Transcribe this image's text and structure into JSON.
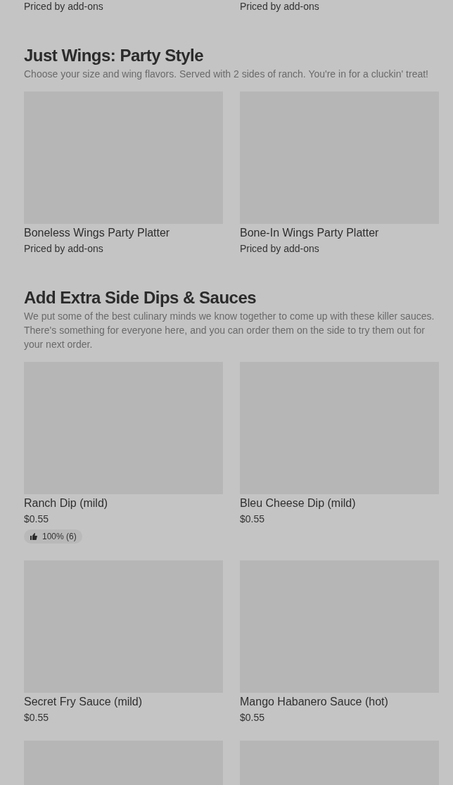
{
  "top_row": [
    {
      "price": "Priced by add-ons"
    },
    {
      "price": "Priced by add-ons"
    }
  ],
  "sections": [
    {
      "title": "Just Wings: Party Style",
      "description": "Choose your size and wing flavors. Served with 2 sides of ranch. You're in for a cluckin' treat!",
      "items": [
        {
          "kind": "product",
          "name": "Boneless Wings Party Platter",
          "price": "Priced by add-ons"
        },
        {
          "kind": "product",
          "name": "Bone-In Wings Party Platter",
          "price": "Priced by add-ons"
        }
      ]
    },
    {
      "title": "Add Extra Side Dips & Sauces",
      "description": "We put some of the best culinary minds we know together to come up with these killer sauces. There's something for everyone here, and you can order them on the side to try them out for your next order.",
      "items": [
        {
          "kind": "product",
          "name": "Ranch Dip (mild)",
          "price": "$0.55",
          "rating": "100% (6)"
        },
        {
          "kind": "product",
          "name": "Bleu Cheese Dip (mild)",
          "price": "$0.55"
        },
        {
          "kind": "product",
          "name": "Secret Fry Sauce (mild)",
          "price": "$0.55"
        },
        {
          "kind": "product",
          "name": "Mango Habanero Sauce (hot)",
          "price": "$0.55"
        },
        {
          "kind": "image"
        },
        {
          "kind": "image"
        }
      ]
    }
  ]
}
